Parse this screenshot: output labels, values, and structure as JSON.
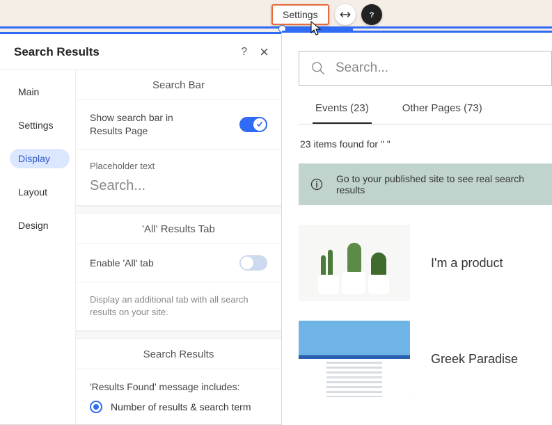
{
  "toolbar": {
    "settings_label": "Settings",
    "element_tag": "Search Results"
  },
  "panel": {
    "title": "Search Results",
    "help": "?",
    "close": "×",
    "tabs": [
      "Main",
      "Settings",
      "Display",
      "Layout",
      "Design"
    ],
    "active_tab_index": 2
  },
  "display": {
    "searchBar": {
      "heading": "Search Bar",
      "show_label": "Show search bar in Results Page",
      "show_value": true,
      "placeholder_label": "Placeholder text",
      "placeholder_value": "Search..."
    },
    "allTab": {
      "heading": "'All' Results Tab",
      "enable_label": "Enable 'All' tab",
      "enable_value": false,
      "description": "Display an additional tab with all search results on your site."
    },
    "searchResults": {
      "heading": "Search Results",
      "results_found_label": "'Results Found' message includes:",
      "radio_option": "Number of results & search term",
      "radio_checked": true
    }
  },
  "preview": {
    "search_placeholder": "Search...",
    "tabs": [
      {
        "label": "Events (23)",
        "active": true
      },
      {
        "label": "Other Pages (73)",
        "active": false
      }
    ],
    "found_text": "23 items found for \" \"",
    "notice": "Go to your published site to see real search results",
    "results": [
      {
        "title": "I'm a product"
      },
      {
        "title": "Greek Paradise"
      }
    ]
  }
}
